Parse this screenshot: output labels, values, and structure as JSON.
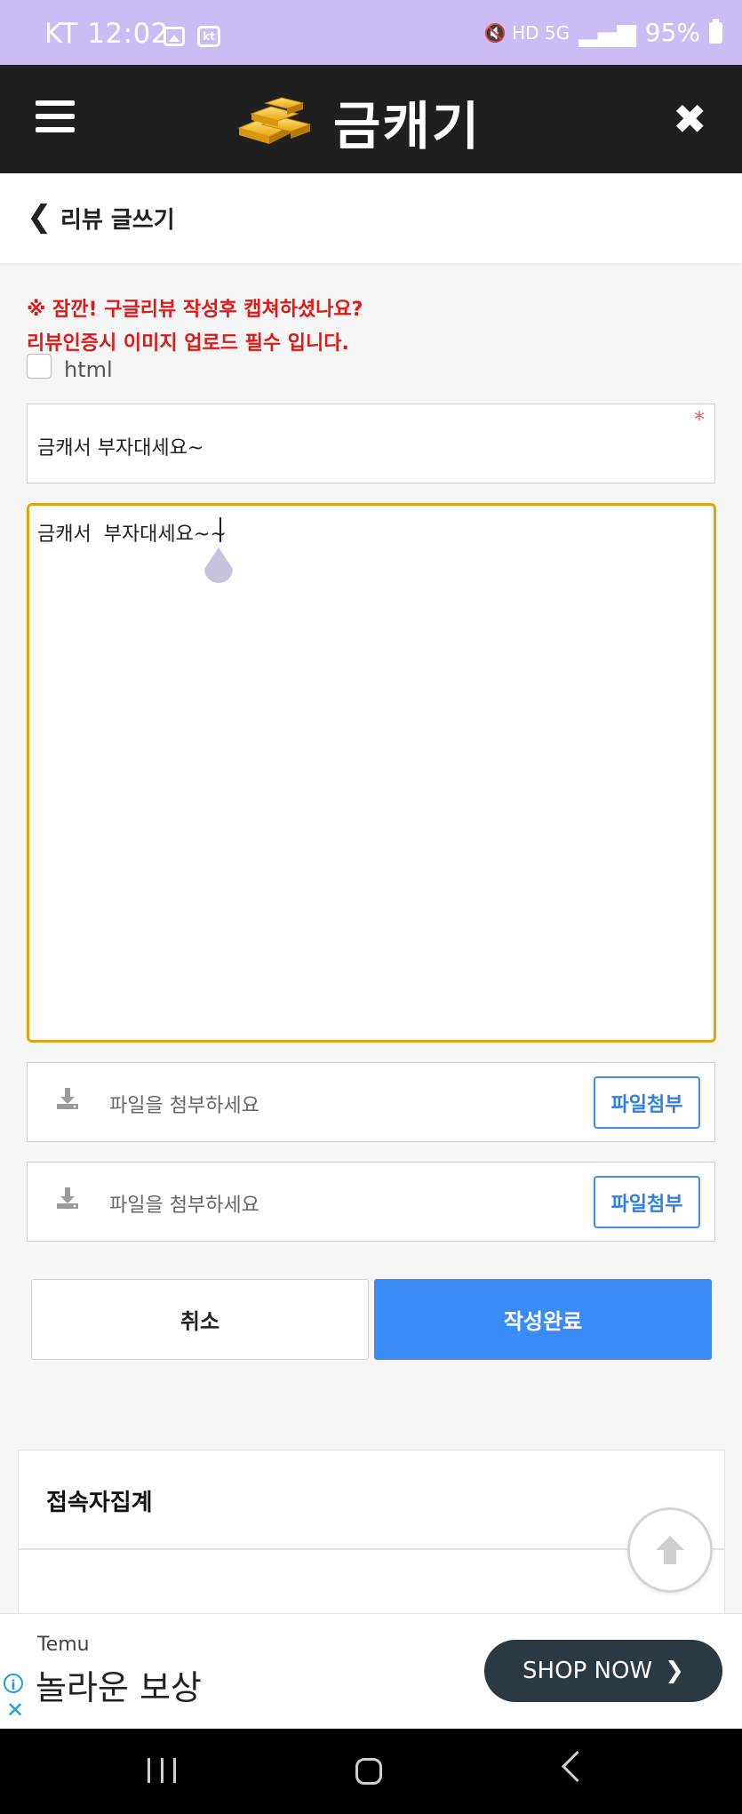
{
  "status_bar": {
    "carrier_time": "KT 12:02",
    "carrier_badge": "kt",
    "network_icons": "🔇 HD 5G",
    "battery": "95%"
  },
  "header": {
    "brand": "금캐기",
    "logo_icon": "gold-bars-icon",
    "menu_icon": "hamburger-icon",
    "close_icon": "close-icon"
  },
  "page": {
    "title": "리뷰 글쓰기"
  },
  "notice": {
    "line1": "※ 잠깐! 구글리뷰 작성후 캡쳐하셨나요?",
    "line2": "리뷰인증시 이미지 업로드 필수 입니다.",
    "color": "#e01818"
  },
  "form": {
    "html_label": "html",
    "subject_value": "금캐서 부자대세요~",
    "required_mark": "*",
    "content_value": "금캐서  부자대세요~~",
    "files": [
      {
        "placeholder": "파일을 첨부하세요",
        "button": "파일첨부"
      },
      {
        "placeholder": "파일을 첨부하세요",
        "button": "파일첨부"
      }
    ],
    "cancel_label": "취소",
    "submit_label": "작성완료"
  },
  "stats": {
    "title": "접속자집계"
  },
  "ad": {
    "brand": "Temu",
    "headline": "놀라운 보상",
    "cta": "SHOP NOW"
  },
  "colors": {
    "accent_blue": "#3b8bf7",
    "focus_border": "#e3a20f",
    "header_bg": "#1f1f1f",
    "status_bar_bg": "#cbbcf6"
  }
}
